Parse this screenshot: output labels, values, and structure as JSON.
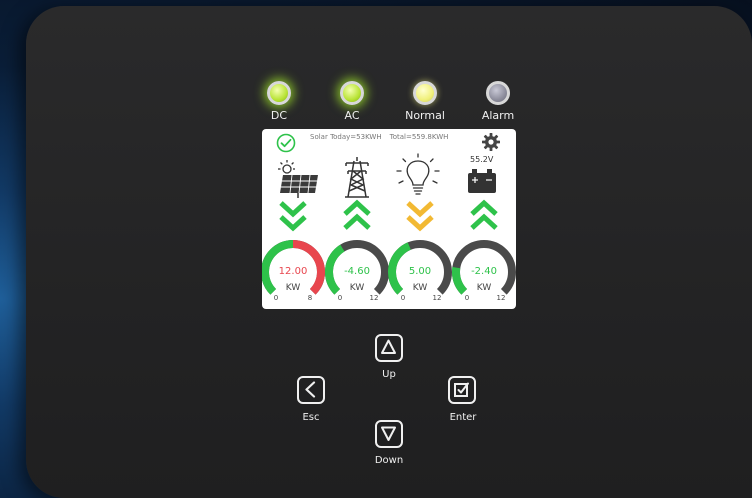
{
  "leds": [
    {
      "label": "DC",
      "state": "green"
    },
    {
      "label": "AC",
      "state": "green"
    },
    {
      "label": "Normal",
      "state": "yellow"
    },
    {
      "label": "Alarm",
      "state": "grey"
    }
  ],
  "screen": {
    "solar_today": "Solar Today=53KWH",
    "total": "Total=559.8KWH",
    "battery_voltage": "55.2V",
    "gauges": [
      {
        "value": "12.00",
        "unit": "KW",
        "min": "0",
        "max": "8",
        "value_color": "#e8464e",
        "arrow_dir": "down",
        "arrow_color": "#2ec24a"
      },
      {
        "value": "-4.60",
        "unit": "KW",
        "min": "0",
        "max": "12",
        "value_color": "#2ec24a",
        "arrow_dir": "up",
        "arrow_color": "#2ec24a"
      },
      {
        "value": "5.00",
        "unit": "KW",
        "min": "0",
        "max": "12",
        "value_color": "#2ec24a",
        "arrow_dir": "down",
        "arrow_color": "#f2b933"
      },
      {
        "value": "-2.40",
        "unit": "KW",
        "min": "0",
        "max": "12",
        "value_color": "#2ec24a",
        "arrow_dir": "up",
        "arrow_color": "#2ec24a"
      }
    ]
  },
  "buttons": {
    "up": "Up",
    "down": "Down",
    "esc": "Esc",
    "enter": "Enter"
  }
}
